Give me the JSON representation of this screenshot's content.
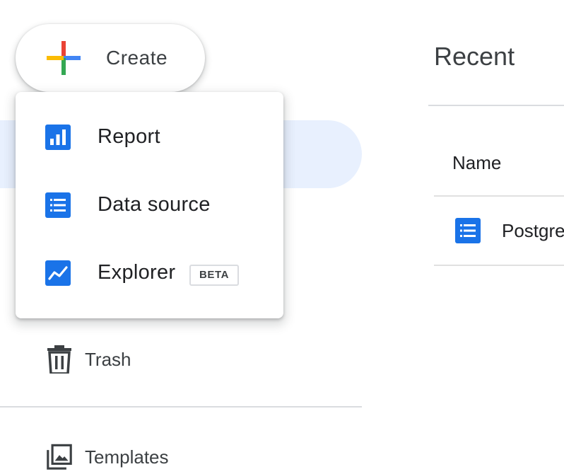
{
  "create_button": {
    "label": "Create",
    "icon": "google-plus-icon",
    "colors": {
      "red": "#EA4335",
      "blue": "#4285F4",
      "green": "#34A853",
      "yellow": "#FBBC04"
    }
  },
  "create_menu": {
    "items": [
      {
        "label": "Report",
        "icon": "report-icon"
      },
      {
        "label": "Data source",
        "icon": "data-source-icon"
      },
      {
        "label": "Explorer",
        "icon": "explorer-icon",
        "badge": "BETA"
      }
    ],
    "icon_color": "#1A73E8"
  },
  "sidebar": {
    "items": [
      {
        "label": "Trash",
        "icon": "trash-icon"
      },
      {
        "label": "Templates",
        "icon": "templates-icon"
      }
    ],
    "active_color": "#E8F0FE"
  },
  "main": {
    "title": "Recent",
    "columns": [
      {
        "label": "Name"
      }
    ],
    "rows": [
      {
        "name": "Postgre",
        "icon": "data-source-icon"
      }
    ]
  }
}
